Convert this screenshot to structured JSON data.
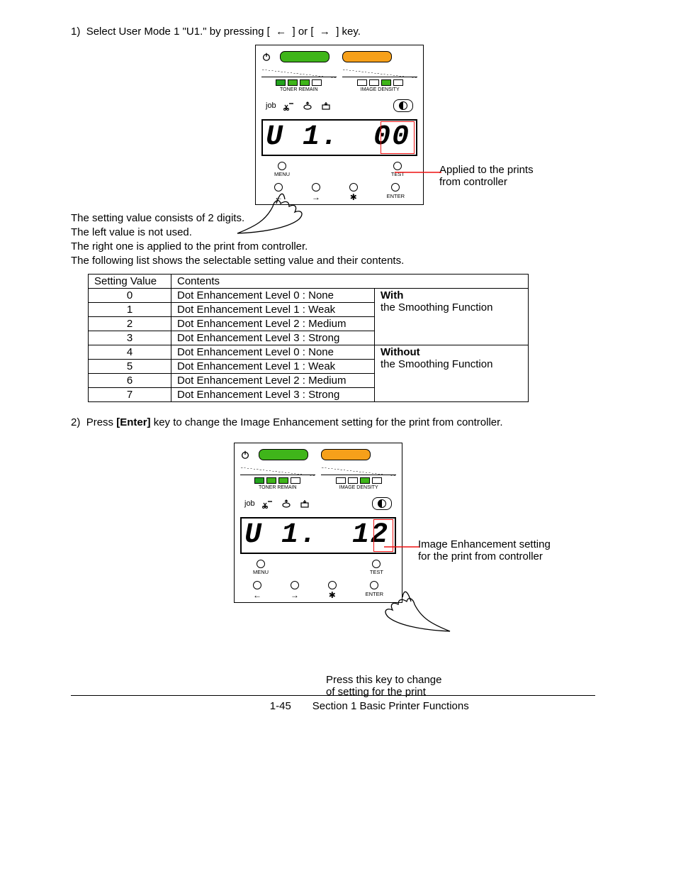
{
  "step1": {
    "num": "1)",
    "text1": "Select User Mode 1 \"U1.\" by pressing [",
    "text2": "] or [",
    "text3": "] key."
  },
  "panelLabels": {
    "toner": "TONER REMAIN",
    "density": "IMAGE DENSITY",
    "job": "job",
    "menu": "MENU",
    "test": "TEST",
    "enter": "ENTER",
    "back": "←",
    "fwd": "→",
    "star": "✱"
  },
  "panel1": {
    "lcd_left": "U 1.",
    "lcd_right": "00",
    "callout1": "Applied to the prints",
    "callout2": "from controller"
  },
  "desc": {
    "l1": "The setting value consists of 2 digits.",
    "l2": "The left value is not used.",
    "l3": "The right one is applied to the print from controller.",
    "l4": "The following list shows the selectable setting value and their contents."
  },
  "table": {
    "h1": "Setting Value",
    "h2": "Contents",
    "group1a": "With",
    "group1b": "the Smoothing Function",
    "group2a": "Without",
    "group2b": "the Smoothing Function",
    "rows": [
      {
        "v": "0",
        "c": "Dot Enhancement Level 0 : None"
      },
      {
        "v": "1",
        "c": "Dot Enhancement Level 1 : Weak"
      },
      {
        "v": "2",
        "c": "Dot Enhancement Level 2 : Medium"
      },
      {
        "v": "3",
        "c": "Dot Enhancement Level 3 : Strong"
      },
      {
        "v": "4",
        "c": "Dot Enhancement Level 0 : None"
      },
      {
        "v": "5",
        "c": "Dot Enhancement Level 1 : Weak"
      },
      {
        "v": "6",
        "c": "Dot Enhancement Level 2 : Medium"
      },
      {
        "v": "7",
        "c": "Dot Enhancement Level 3 : Strong"
      }
    ]
  },
  "step2": {
    "num": "2)",
    "t1": "Press ",
    "bold": "[Enter]",
    "t2": " key to change the Image Enhancement setting for the print from controller."
  },
  "panel2": {
    "lcd_left": "U 1.",
    "lcd_right": "12",
    "callout1": "Image Enhancement setting",
    "callout2": "for the print from controller",
    "below1": "Press this key to change",
    "below2": "of setting for the print"
  },
  "footer": {
    "page": "1-45",
    "section": "Section 1     Basic Printer Functions"
  }
}
